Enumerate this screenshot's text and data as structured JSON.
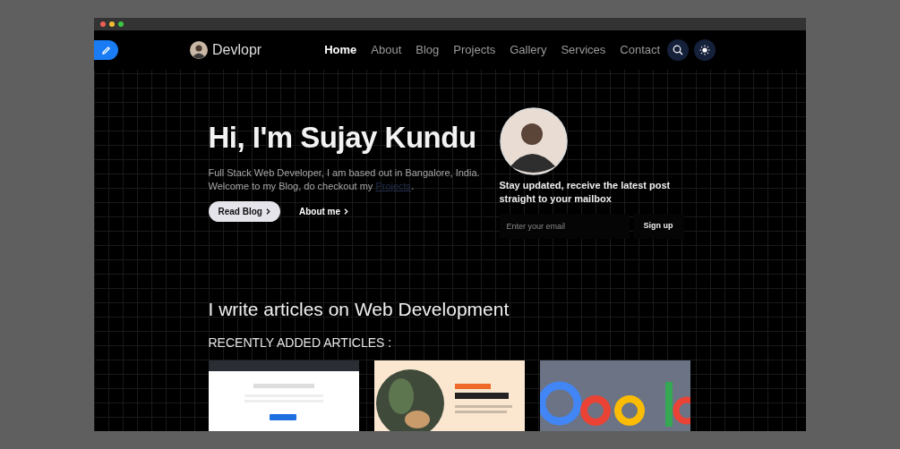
{
  "navbar": {
    "brand": "Devlopr",
    "links": [
      {
        "label": "Home",
        "selected": true
      },
      {
        "label": "About",
        "selected": false
      },
      {
        "label": "Blog",
        "selected": false
      },
      {
        "label": "Projects",
        "selected": false
      },
      {
        "label": "Gallery",
        "selected": false
      },
      {
        "label": "Services",
        "selected": false
      },
      {
        "label": "Contact",
        "selected": false
      }
    ]
  },
  "hero": {
    "title": "Hi, I'm Sujay Kundu",
    "intro": "Full Stack Web Developer, I am based out in Bangalore, India. Welcome to my Blog, do checkout my ",
    "intro_link": "Projects",
    "intro_end": ".",
    "buttons": [
      {
        "label": "Read Blog",
        "kind": "filled"
      },
      {
        "label": "About me",
        "kind": "plain"
      }
    ]
  },
  "subscribe": {
    "text": "Stay updated, receive the latest post straight to your mailbox",
    "placeholder": "Enter your email",
    "button": "Sign up"
  },
  "articles": {
    "heading": "I write articles on Web Development",
    "subheading": "RECENTLY ADDED ARTICLES :"
  }
}
